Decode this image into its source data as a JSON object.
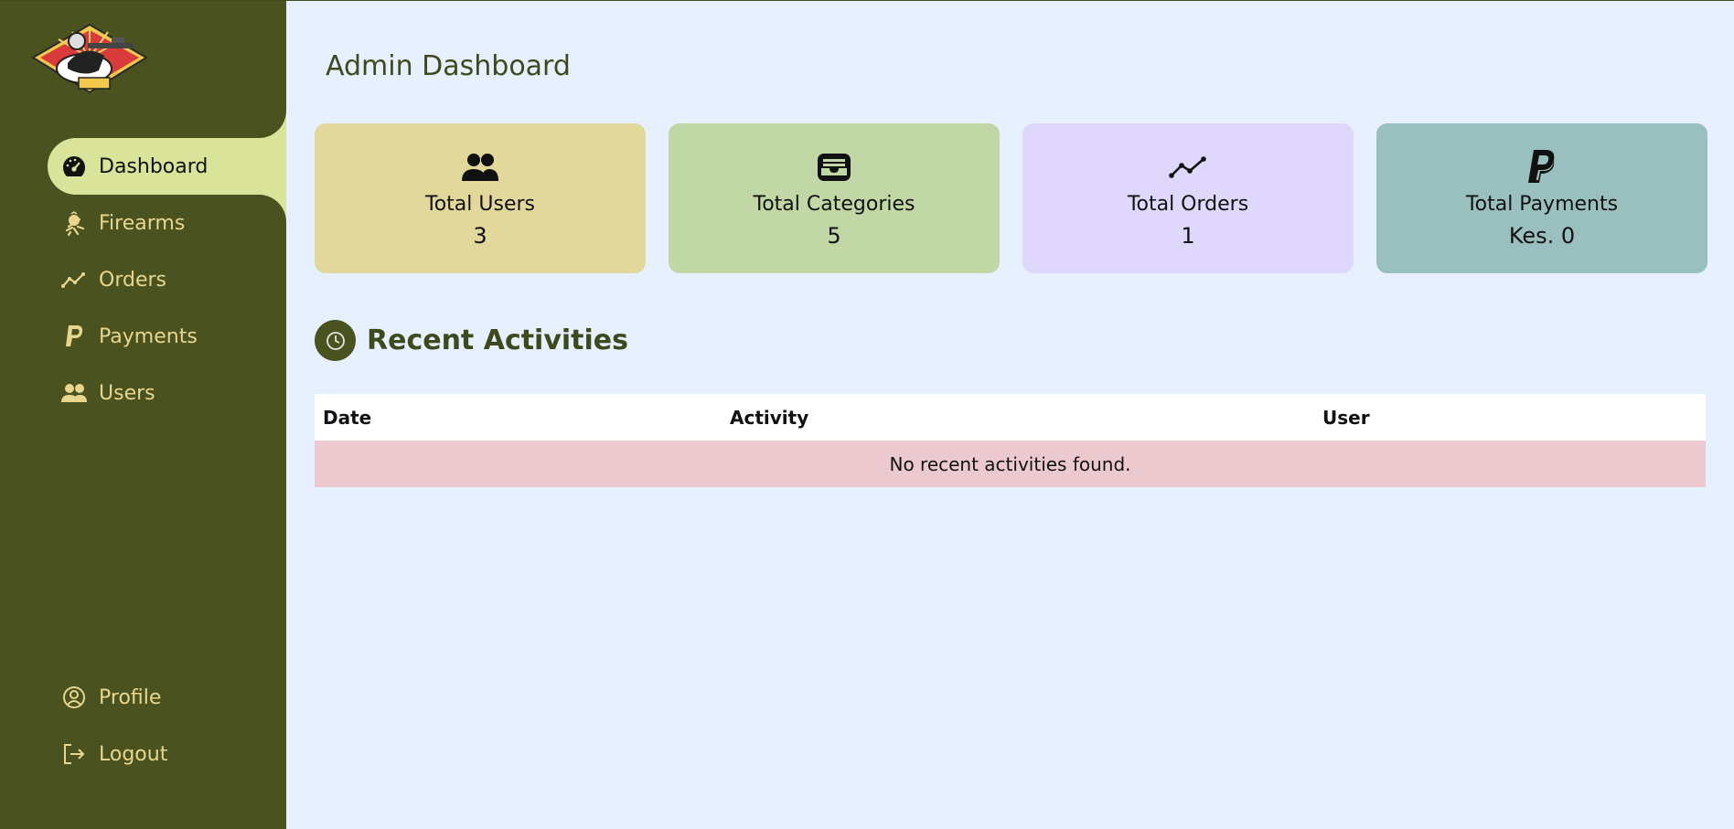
{
  "sidebar": {
    "logo_icon": "marksman-logo",
    "items": [
      {
        "label": "Dashboard",
        "icon": "speedometer-icon",
        "active": true
      },
      {
        "label": "Firearms",
        "icon": "firearm-icon",
        "active": false
      },
      {
        "label": "Orders",
        "icon": "trend-line-icon",
        "active": false
      },
      {
        "label": "Payments",
        "icon": "paypal-icon",
        "active": false
      },
      {
        "label": "Users",
        "icon": "users-icon",
        "active": false
      }
    ],
    "bottom_items": [
      {
        "label": "Profile",
        "icon": "user-circle-icon"
      },
      {
        "label": "Logout",
        "icon": "logout-icon"
      }
    ]
  },
  "main": {
    "title": "Admin Dashboard",
    "cards": [
      {
        "title": "Total Users",
        "value": "3",
        "icon": "users-icon",
        "color": "#e3d89c"
      },
      {
        "title": "Total Categories",
        "value": "5",
        "icon": "inbox-icon",
        "color": "#c1d7a5"
      },
      {
        "title": "Total Orders",
        "value": "1",
        "icon": "trend-line-icon",
        "color": "#e0d7fd"
      },
      {
        "title": "Total Payments",
        "value": "Kes. 0",
        "icon": "paypal-icon",
        "color": "#99bfbe"
      }
    ],
    "recent": {
      "title": "Recent Activities",
      "icon": "clock-icon",
      "columns": [
        "Date",
        "Activity",
        "User"
      ],
      "empty_message": "No recent activities found."
    }
  },
  "colors": {
    "sidebar_bg": "#4a5220",
    "sidebar_text": "#e8d68e",
    "active_bg": "#d9e39a",
    "page_bg": "#e6f0fe",
    "heading": "#3e4a1e",
    "empty_row": "#ebc9cf"
  }
}
